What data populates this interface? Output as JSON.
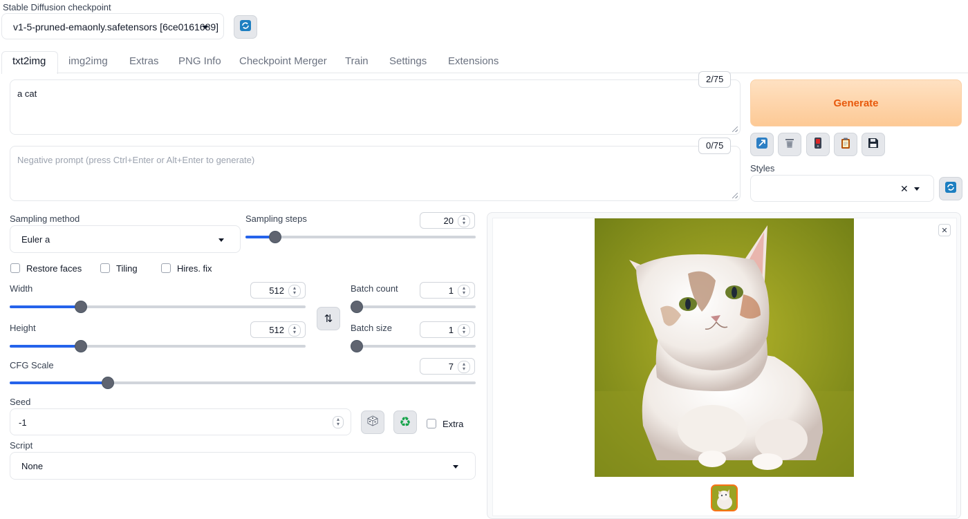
{
  "checkpoint": {
    "label": "Stable Diffusion checkpoint",
    "value": "v1-5-pruned-emaonly.safetensors [6ce0161689]",
    "refresh_icon": "refresh-icon"
  },
  "tabs": [
    "txt2img",
    "img2img",
    "Extras",
    "PNG Info",
    "Checkpoint Merger",
    "Train",
    "Settings",
    "Extensions"
  ],
  "active_tab": "txt2img",
  "prompt": {
    "value": "a cat",
    "counter": "2/75"
  },
  "negative_prompt": {
    "placeholder": "Negative prompt (press Ctrl+Enter or Alt+Enter to generate)",
    "value": "",
    "counter": "0/75"
  },
  "generate": {
    "label": "Generate",
    "color": "#e8590c"
  },
  "tool_icons": [
    "read-params-icon",
    "trash-icon",
    "paste-style-icon",
    "clipboard-icon",
    "save-style-icon"
  ],
  "styles": {
    "label": "Styles",
    "value": ""
  },
  "sampling_method": {
    "label": "Sampling method",
    "value": "Euler a"
  },
  "sampling_steps": {
    "label": "Sampling steps",
    "value": "20",
    "level": 0.13
  },
  "checkboxes": {
    "restore_faces": "Restore faces",
    "tiling": "Tiling",
    "hires_fix": "Hires. fix",
    "extra": "Extra"
  },
  "width": {
    "label": "Width",
    "value": "512",
    "level": 0.24
  },
  "height": {
    "label": "Height",
    "value": "512",
    "level": 0.24
  },
  "batch_count": {
    "label": "Batch count",
    "value": "1",
    "level": 0.0
  },
  "batch_size": {
    "label": "Batch size",
    "value": "1",
    "level": 0.0
  },
  "cfg_scale": {
    "label": "CFG Scale",
    "value": "7",
    "level": 0.21
  },
  "seed": {
    "label": "Seed",
    "value": "-1"
  },
  "script": {
    "label": "Script",
    "value": "None"
  },
  "output": {
    "close_icon": "close-icon",
    "image": "generated cat image"
  },
  "colors": {
    "accent": "#2563eb",
    "generate_bg": "#fed7aa",
    "generate_text": "#e8590c",
    "thumb_border": "#f97316"
  }
}
